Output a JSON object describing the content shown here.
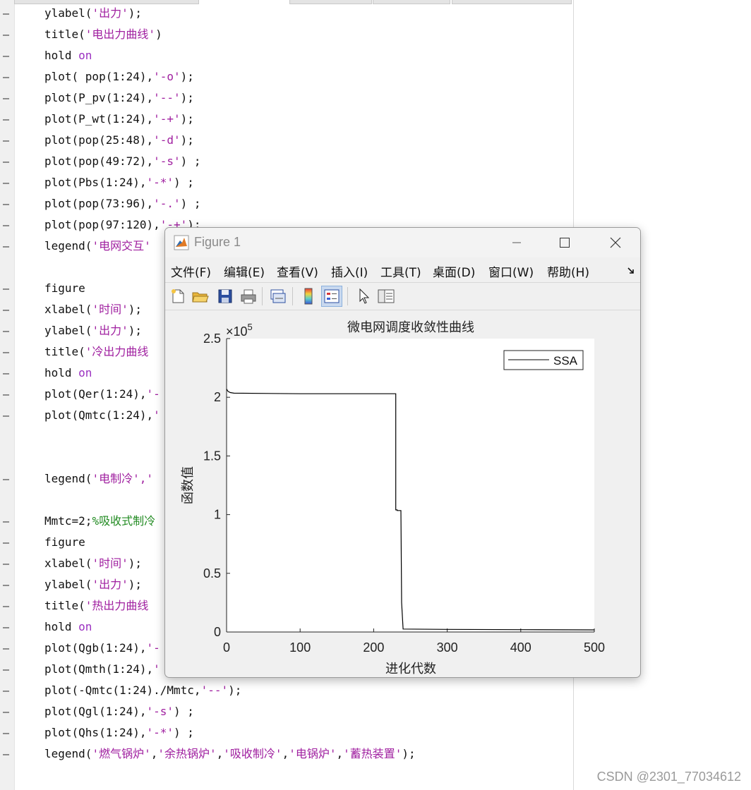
{
  "editor": {
    "lines": [
      {
        "top": 4,
        "parts": [
          [
            "t",
            "ylabel("
          ],
          [
            "s",
            "'出力'"
          ],
          [
            "t",
            ");"
          ]
        ]
      },
      {
        "top": 34,
        "parts": [
          [
            "t",
            "title("
          ],
          [
            "s",
            "'电出力曲线'"
          ],
          [
            "t",
            ")"
          ]
        ]
      },
      {
        "top": 64,
        "parts": [
          [
            "t",
            "hold "
          ],
          [
            "k",
            "on"
          ]
        ]
      },
      {
        "top": 94,
        "parts": [
          [
            "t",
            "plot( pop(1:24),"
          ],
          [
            "s",
            "'-o'"
          ],
          [
            "t",
            ");"
          ]
        ]
      },
      {
        "top": 124,
        "parts": [
          [
            "t",
            "plot(P_pv(1:24),"
          ],
          [
            "s",
            "'--'"
          ],
          [
            "t",
            ");"
          ]
        ]
      },
      {
        "top": 154,
        "parts": [
          [
            "t",
            "plot(P_wt(1:24),"
          ],
          [
            "s",
            "'-+'"
          ],
          [
            "t",
            ");"
          ]
        ]
      },
      {
        "top": 184,
        "parts": [
          [
            "t",
            "plot(pop(25:48),"
          ],
          [
            "s",
            "'-d'"
          ],
          [
            "t",
            ");"
          ]
        ]
      },
      {
        "top": 214,
        "parts": [
          [
            "t",
            "plot(pop(49:72),"
          ],
          [
            "s",
            "'-s'"
          ],
          [
            "t",
            ") ;"
          ]
        ]
      },
      {
        "top": 244,
        "parts": [
          [
            "t",
            "plot(Pbs(1:24),"
          ],
          [
            "s",
            "'-*'"
          ],
          [
            "t",
            ") ;"
          ]
        ]
      },
      {
        "top": 274,
        "parts": [
          [
            "t",
            "plot(pop(73:96),"
          ],
          [
            "s",
            "'-.'"
          ],
          [
            "t",
            ") ;"
          ]
        ]
      },
      {
        "top": 304,
        "parts": [
          [
            "t",
            "plot(pop(97:120),"
          ],
          [
            "s",
            "'-+'"
          ],
          [
            "t",
            ");"
          ]
        ]
      },
      {
        "top": 334,
        "parts": [
          [
            "t",
            "legend("
          ],
          [
            "s",
            "'电网交互'"
          ]
        ]
      },
      {
        "top": 394,
        "parts": [
          [
            "t",
            "figure"
          ]
        ]
      },
      {
        "top": 424,
        "parts": [
          [
            "t",
            "xlabel("
          ],
          [
            "s",
            "'时间'"
          ],
          [
            "t",
            ");"
          ]
        ]
      },
      {
        "top": 454,
        "parts": [
          [
            "t",
            "ylabel("
          ],
          [
            "s",
            "'出力'"
          ],
          [
            "t",
            ");"
          ]
        ]
      },
      {
        "top": 484,
        "parts": [
          [
            "t",
            "title("
          ],
          [
            "s",
            "'冷出力曲线"
          ]
        ]
      },
      {
        "top": 514,
        "parts": [
          [
            "t",
            "hold "
          ],
          [
            "k",
            "on"
          ]
        ]
      },
      {
        "top": 544,
        "parts": [
          [
            "t",
            "plot(Qer(1:24),"
          ],
          [
            "s",
            "'-"
          ]
        ]
      },
      {
        "top": 574,
        "parts": [
          [
            "t",
            "plot(Qmtc(1:24),"
          ],
          [
            "s",
            "'"
          ]
        ]
      },
      {
        "top": 664,
        "parts": [
          [
            "t",
            "legend("
          ],
          [
            "s",
            "'电制冷',"
          ],
          [
            "s",
            "'"
          ]
        ]
      },
      {
        "top": 724,
        "parts": [
          [
            "t",
            "Mmtc=2;"
          ],
          [
            "c",
            "%吸收式制冷"
          ]
        ]
      },
      {
        "top": 754,
        "parts": [
          [
            "t",
            "figure"
          ]
        ]
      },
      {
        "top": 784,
        "parts": [
          [
            "t",
            "xlabel("
          ],
          [
            "s",
            "'时间'"
          ],
          [
            "t",
            ");"
          ]
        ]
      },
      {
        "top": 814,
        "parts": [
          [
            "t",
            "ylabel("
          ],
          [
            "s",
            "'出力'"
          ],
          [
            "t",
            ");"
          ]
        ]
      },
      {
        "top": 844,
        "parts": [
          [
            "t",
            "title("
          ],
          [
            "s",
            "'热出力曲线"
          ]
        ]
      },
      {
        "top": 874,
        "parts": [
          [
            "t",
            "hold "
          ],
          [
            "k",
            "on"
          ]
        ]
      },
      {
        "top": 904,
        "parts": [
          [
            "t",
            "plot(Qgb(1:24),"
          ],
          [
            "s",
            "'-"
          ]
        ]
      },
      {
        "top": 934,
        "parts": [
          [
            "t",
            "plot(Qmth(1:24),"
          ],
          [
            "s",
            "'"
          ]
        ]
      },
      {
        "top": 964,
        "parts": [
          [
            "t",
            "plot(-Qmtc(1:24)./Mmtc,"
          ],
          [
            "s",
            "'--'"
          ],
          [
            "t",
            ");"
          ]
        ]
      },
      {
        "top": 994,
        "parts": [
          [
            "t",
            "plot(Qgl(1:24),"
          ],
          [
            "s",
            "'-s'"
          ],
          [
            "t",
            ") ;"
          ]
        ]
      },
      {
        "top": 1024,
        "parts": [
          [
            "t",
            "plot(Qhs(1:24),"
          ],
          [
            "s",
            "'-*'"
          ],
          [
            "t",
            ") ;"
          ]
        ]
      },
      {
        "top": 1054,
        "parts": [
          [
            "t",
            "legend("
          ],
          [
            "s",
            "'燃气锅炉'"
          ],
          [
            "t",
            ","
          ],
          [
            "s",
            "'余热锅炉'"
          ],
          [
            "t",
            ","
          ],
          [
            "s",
            "'吸收制冷'"
          ],
          [
            "t",
            ","
          ],
          [
            "s",
            "'电锅炉'"
          ],
          [
            "t",
            ","
          ],
          [
            "s",
            "'蓄热装置'"
          ],
          [
            "t",
            ");"
          ]
        ]
      }
    ],
    "gutter_marker": "—",
    "watermark": "CSDN @2301_77034612"
  },
  "figure_window": {
    "title": "Figure 1",
    "menu": [
      "文件(F)",
      "编辑(E)",
      "查看(V)",
      "插入(I)",
      "工具(T)",
      "桌面(D)",
      "窗口(W)",
      "帮助(H)"
    ],
    "toolbar_icons": [
      "new-figure-icon",
      "open-file-icon",
      "save-icon",
      "print-icon",
      "link-plot-icon",
      "colorbar-icon",
      "legend-icon",
      "pointer-icon",
      "property-inspector-icon"
    ]
  },
  "chart_data": {
    "type": "line",
    "title": "微电网调度收敛性曲线",
    "xlabel": "进化代数",
    "ylabel": "函数值",
    "xlim": [
      0,
      500
    ],
    "ylim": [
      0,
      250000
    ],
    "y_exponent_label": "×10",
    "y_exponent_power": "5",
    "xticks": [
      "0",
      "100",
      "200",
      "300",
      "400",
      "500"
    ],
    "yticks": [
      "0",
      "0.5",
      "1",
      "1.5",
      "2",
      "2.5"
    ],
    "grid": false,
    "legend_position": "top-right",
    "series": [
      {
        "name": "SSA",
        "color": "#000000",
        "x": [
          0,
          2,
          5,
          10,
          100,
          200,
          230,
          230,
          232,
          232,
          237,
          238,
          240,
          300,
          400,
          500
        ],
        "y": [
          207000,
          205000,
          204000,
          203500,
          203000,
          203000,
          203000,
          104000,
          104000,
          103500,
          103500,
          25000,
          2500,
          2200,
          2000,
          1800
        ]
      }
    ]
  }
}
